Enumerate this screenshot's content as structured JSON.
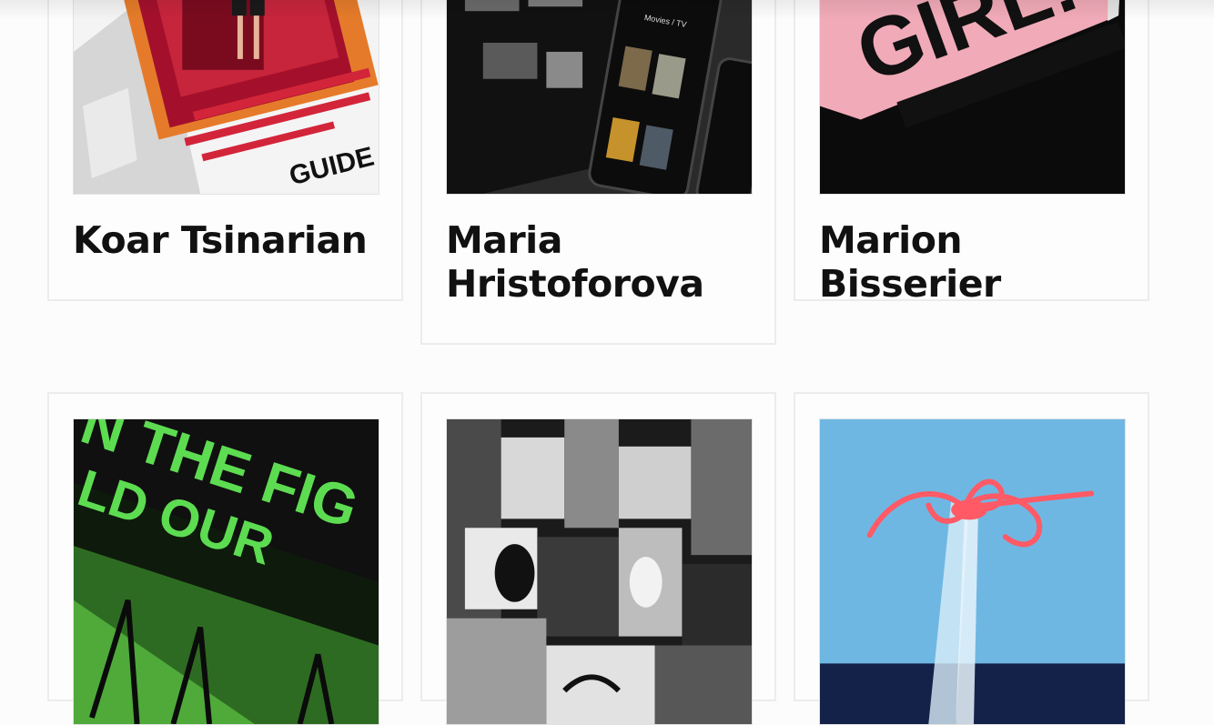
{
  "cards": [
    {
      "name": "Koar Tsinarian",
      "image_label": "GUIDE"
    },
    {
      "name": "Maria Hristoforova",
      "image_label": "Movies / TV"
    },
    {
      "name": "Marion Bisserier",
      "image_label": "GIRL!"
    },
    {
      "name": "",
      "image_label": "N THE FIG"
    },
    {
      "name": "",
      "image_label": ""
    },
    {
      "name": "",
      "image_label": ""
    }
  ],
  "colors": {
    "accent_red": "#d3253a",
    "accent_green": "#5ddc52",
    "sky_blue": "#6fb7e3",
    "pink": "#f1aab8"
  }
}
